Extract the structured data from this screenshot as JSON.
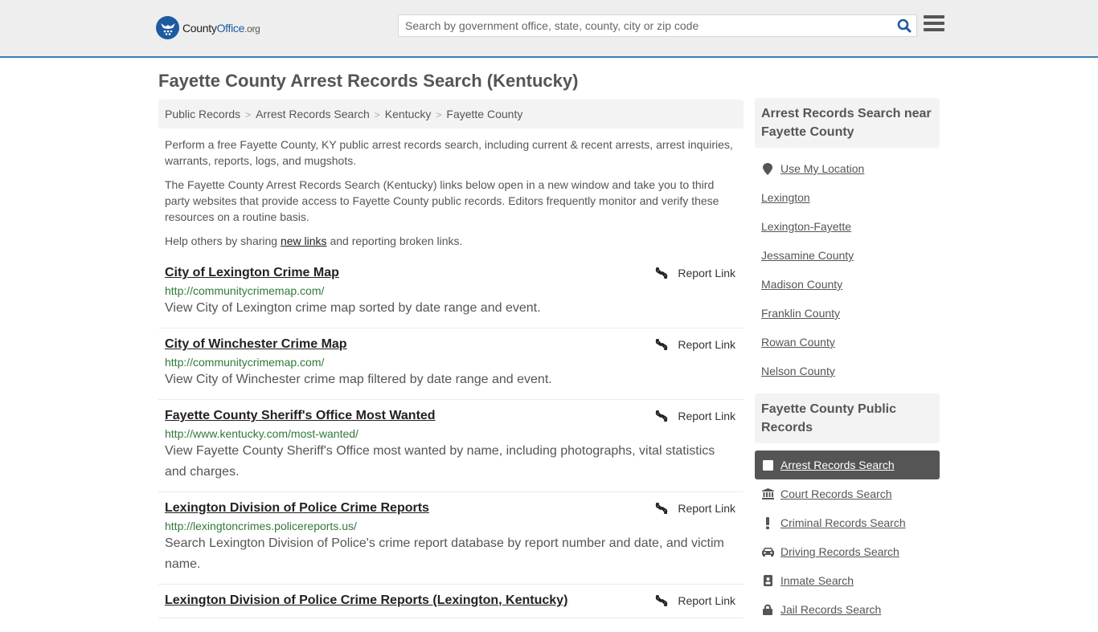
{
  "header": {
    "logo": {
      "part1": "County",
      "part2": "Office",
      "part3": ".org"
    },
    "search_placeholder": "Search by government office, state, county, city or zip code",
    "search_icon": "search-icon",
    "menu_icon": "hamburger-menu-icon",
    "accent_color": "#3d7fb5"
  },
  "page": {
    "title": "Fayette County Arrest Records Search (Kentucky)",
    "breadcrumb": [
      {
        "label": "Public Records"
      },
      {
        "label": "Arrest Records Search"
      },
      {
        "label": "Kentucky"
      },
      {
        "label": "Fayette County"
      }
    ],
    "breadcrumb_separator": ">",
    "intro": {
      "p1": "Perform a free Fayette County, KY public arrest records search, including current & recent arrests, arrest inquiries, warrants, reports, logs, and mugshots.",
      "p2": "The Fayette County Arrest Records Search (Kentucky) links below open in a new window and take you to third party websites that provide access to Fayette County public records. Editors frequently monitor and verify these resources on a routine basis.",
      "p3_before": "Help others by sharing ",
      "p3_link": "new links",
      "p3_after": " and reporting broken links."
    }
  },
  "results": [
    {
      "title": "City of Lexington Crime Map",
      "url": "http://communitycrimemap.com/",
      "description": "View City of Lexington crime map sorted by date range and event.",
      "report_label": "Report Link"
    },
    {
      "title": "City of Winchester Crime Map",
      "url": "http://communitycrimemap.com/",
      "description": "View City of Winchester crime map filtered by date range and event.",
      "report_label": "Report Link"
    },
    {
      "title": "Fayette County Sheriff's Office Most Wanted",
      "url": "http://www.kentucky.com/most-wanted/",
      "description": "View Fayette County Sheriff's Office most wanted by name, including photographs, vital statistics and charges.",
      "report_label": "Report Link"
    },
    {
      "title": "Lexington Division of Police Crime Reports",
      "url": "http://lexingtoncrimes.policereports.us/",
      "description": "Search Lexington Division of Police's crime report database by report number and date, and victim name.",
      "report_label": "Report Link"
    },
    {
      "title": "Lexington Division of Police Crime Reports (Lexington, Kentucky)",
      "url": "",
      "description": "",
      "report_label": "Report Link"
    }
  ],
  "sidebar": {
    "nearby_heading": "Arrest Records Search near Fayette County",
    "use_location": "Use My Location",
    "nearby": [
      "Lexington",
      "Lexington-Fayette",
      "Jessamine County",
      "Madison County",
      "Franklin County",
      "Rowan County",
      "Nelson County"
    ],
    "public_records_heading": "Fayette County Public Records",
    "public_records": [
      {
        "label": "Arrest Records Search",
        "icon": "square-icon",
        "active": true
      },
      {
        "label": "Court Records Search",
        "icon": "courthouse-icon",
        "active": false
      },
      {
        "label": "Criminal Records Search",
        "icon": "exclamation-icon",
        "active": false
      },
      {
        "label": "Driving Records Search",
        "icon": "car-icon",
        "active": false
      },
      {
        "label": "Inmate Search",
        "icon": "id-badge-icon",
        "active": false
      },
      {
        "label": "Jail Records Search",
        "icon": "lock-icon",
        "active": false
      }
    ]
  }
}
